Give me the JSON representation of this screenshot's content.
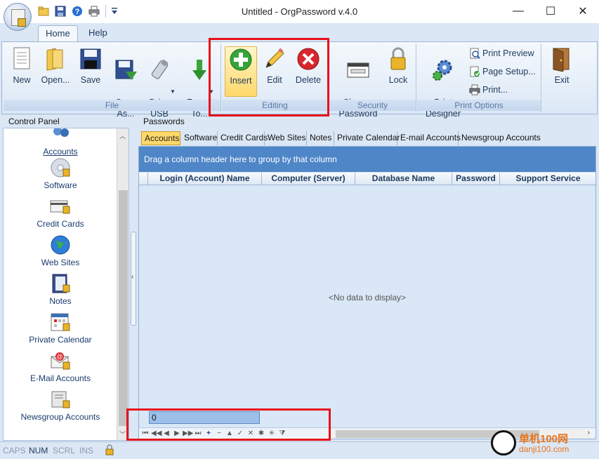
{
  "window": {
    "title": "Untitled - OrgPassword v.4.0",
    "minimize": "—",
    "maximize": "☐",
    "close": "✕"
  },
  "ribbon_tabs": [
    {
      "label": "Home"
    },
    {
      "label": "Help"
    }
  ],
  "groups": {
    "file": {
      "label": "File",
      "buttons": [
        "New",
        "Open...",
        "Save",
        "Save\nAs...",
        "Drive\nUSB",
        "Export\nTo..."
      ]
    },
    "editing": {
      "label": "Editing",
      "buttons": [
        "Insert",
        "Edit",
        "Delete"
      ]
    },
    "security": {
      "label": "Security",
      "buttons": [
        "Change\nPassword",
        "Lock"
      ]
    },
    "print_options": {
      "label": "Print Options",
      "designer": "Print\nDesigner",
      "preview": "Print Preview",
      "page_setup": "Page Setup...",
      "print": "Print..."
    },
    "exit": {
      "label": "Exit"
    }
  },
  "control_panel": {
    "title": "Control Panel",
    "items": [
      {
        "label": "Accounts",
        "icon": "users-icon"
      },
      {
        "label": "Software",
        "icon": "cd-icon"
      },
      {
        "label": "Credit Cards",
        "icon": "credit-card-icon"
      },
      {
        "label": "Web Sites",
        "icon": "globe-icon"
      },
      {
        "label": "Notes",
        "icon": "notebook-icon"
      },
      {
        "label": "Private Calendar",
        "icon": "calendar-icon"
      },
      {
        "label": "E-Mail Accounts",
        "icon": "email-icon"
      },
      {
        "label": "Newsgroup Accounts",
        "icon": "newsgroup-icon"
      }
    ]
  },
  "passwords": {
    "title": "Passwords",
    "tabs": [
      "Accounts",
      "Software",
      "Credit Cards",
      "Web Sites",
      "Notes",
      "Private Calendar",
      "E-mail Accounts",
      "Newsgroup Accounts"
    ],
    "group_hint": "Drag a column header here to group by that column",
    "columns": [
      "Login (Account) Name",
      "Computer (Server)",
      "Database Name",
      "Password",
      "Support Service"
    ],
    "empty_text": "<No data to display>",
    "record_count": "0"
  },
  "status": {
    "caps": "CAPS",
    "num": "NUM",
    "scrl": "SCRL",
    "ins": "INS"
  },
  "watermark": {
    "text": "单机100网",
    "sub": "danji100.com"
  },
  "colors": {
    "accent": "#4f86c8",
    "highlight": "#ffd86a",
    "annotation": "#e8111a"
  }
}
